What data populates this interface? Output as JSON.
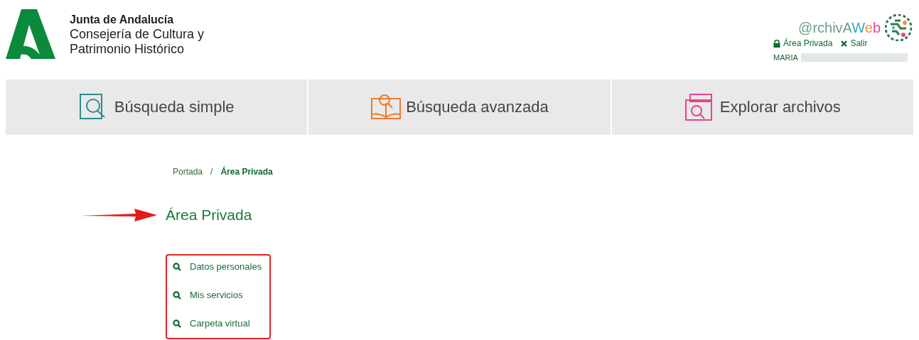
{
  "header": {
    "org": "Junta de Andalucía",
    "department_line_1": "Consejería de Cultura y",
    "department_line_2": "Patrimonio Histórico",
    "app_logo": [
      {
        "text": "@rchivA",
        "color": "#6e9e86"
      },
      {
        "text": "W",
        "color": "#2fa8cc"
      },
      {
        "text": "e",
        "color": "#f0923a"
      },
      {
        "text": "b",
        "color": "#e8418f"
      }
    ],
    "user_links": [
      {
        "kind": "lock",
        "label": "Área Privada"
      },
      {
        "kind": "close",
        "label": "Salir"
      }
    ],
    "user_name": "MARIA"
  },
  "nav": [
    {
      "kind": "simple",
      "label": "Búsqueda simple",
      "color": "#2e8b8b"
    },
    {
      "kind": "advanced",
      "label": "Búsqueda avanzada",
      "color": "#f07a2a"
    },
    {
      "kind": "explore",
      "label": "Explorar archivos",
      "color": "#e8418f"
    }
  ],
  "breadcrumb_separator": "/",
  "breadcrumb": [
    {
      "label": "Portada",
      "selected": false
    },
    {
      "label": "Área Privada",
      "selected": true
    }
  ],
  "page_title": "Área Privada",
  "menu": [
    {
      "label": "Datos personales"
    },
    {
      "label": "Mis servicios"
    },
    {
      "label": "Carpeta virtual"
    }
  ]
}
